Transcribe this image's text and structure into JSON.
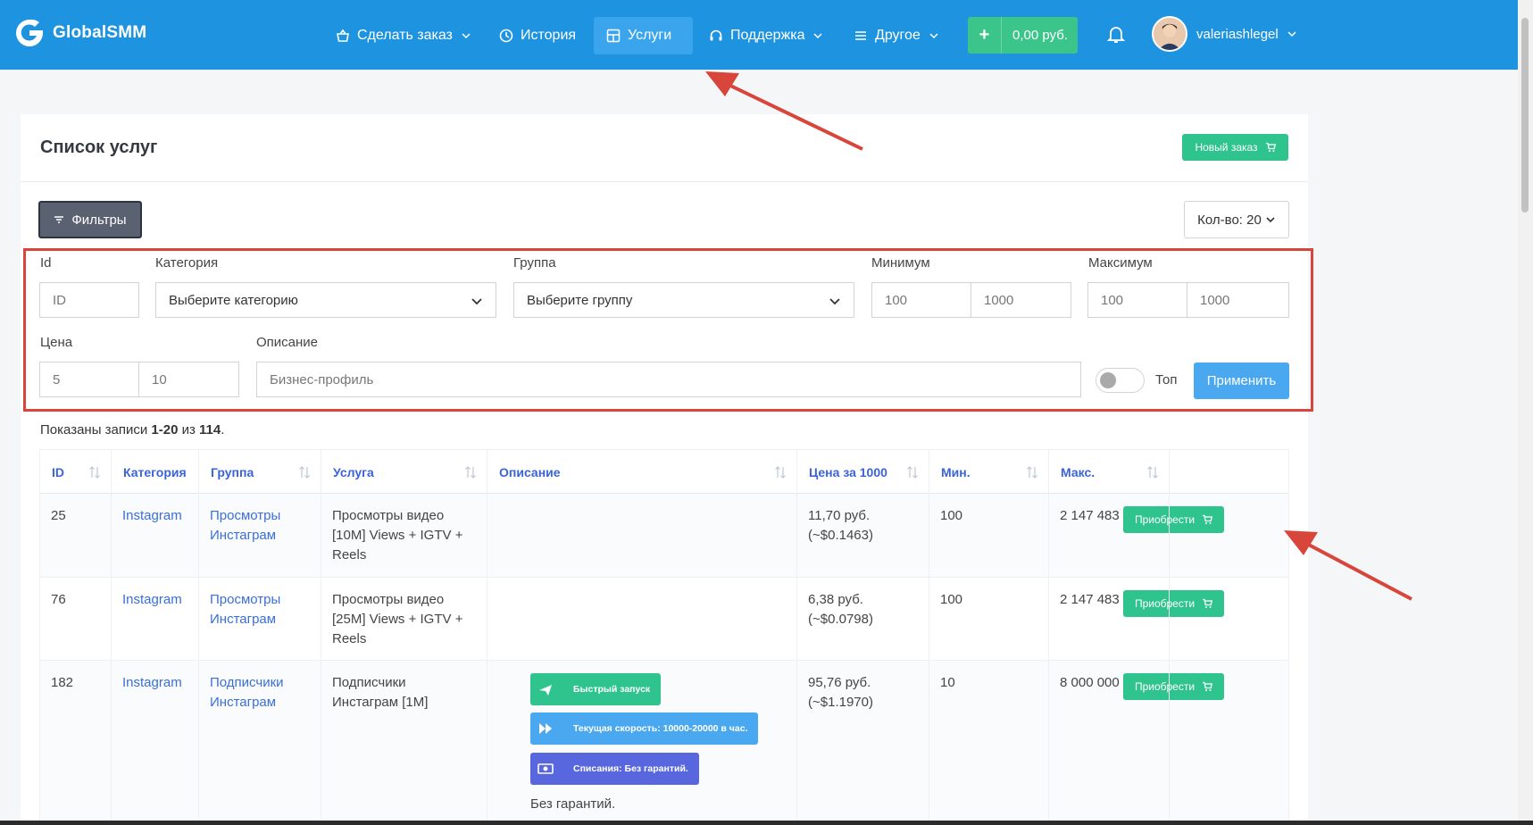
{
  "brand": {
    "name": "GlobalSMM"
  },
  "nav": {
    "order": "Сделать заказ",
    "history": "История",
    "services": "Услуги",
    "support": "Поддержка",
    "other": "Другое",
    "balance": "0,00 руб.",
    "username": "valeriashlegel"
  },
  "page": {
    "title": "Список услуг",
    "new_order": "Новый заказ",
    "filters_btn": "Фильтры",
    "qty": "Кол-во: 20"
  },
  "filters": {
    "id_label": "Id",
    "id_placeholder": "ID",
    "category_label": "Категория",
    "category_value": "Выберите категорию",
    "group_label": "Группа",
    "group_value": "Выберите группу",
    "min_label": "Минимум",
    "min_from": "100",
    "min_to": "1000",
    "max_label": "Максимум",
    "max_from": "100",
    "max_to": "1000",
    "price_label": "Цена",
    "price_from": "5",
    "price_to": "10",
    "desc_label": "Описание",
    "desc_placeholder": "Бизнес-профиль",
    "top_label": "Топ",
    "apply": "Применить"
  },
  "records": {
    "prefix": "Показаны записи ",
    "range": "1-20",
    "mid": " из ",
    "total": "114",
    "suffix": "."
  },
  "table": {
    "headers": [
      "ID",
      "Категория",
      "Группа",
      "Услуга",
      "Описание",
      "Цена за 1000",
      "Мин.",
      "Макс."
    ],
    "buy": "Приобрести",
    "rows": [
      {
        "id": "25",
        "category": "Instagram",
        "group": [
          "Просмотры",
          "Инстаграм"
        ],
        "service": [
          "Просмотры видео",
          "[10M] Views + IGTV +",
          "Reels"
        ],
        "price": [
          "11,70 руб.",
          "(~$0.1463)"
        ],
        "min": "100",
        "max": "2 147 483 647"
      },
      {
        "id": "76",
        "category": "Instagram",
        "group": [
          "Просмотры",
          "Инстаграм"
        ],
        "service": [
          "Просмотры видео",
          "[25M] Views + IGTV +",
          "Reels"
        ],
        "price": [
          "6,38 руб.",
          "(~$0.0798)"
        ],
        "min": "100",
        "max": "2 147 483 647"
      },
      {
        "id": "182",
        "category": "Instagram",
        "group": [
          "Подписчики",
          "Инстаграм"
        ],
        "service": [
          "Подписчики",
          "Инстаграм [1M]"
        ],
        "price": [
          "95,76 руб.",
          "(~$1.1970)"
        ],
        "min": "10",
        "max": "8 000 000",
        "badges": [
          "Быстрый запуск",
          "Текущая скорость: 10000-20000 в час.",
          "Списания: Без гарантий."
        ],
        "note": "Без гарантий."
      }
    ]
  },
  "colors": {
    "navbar": "#1e93e0",
    "green": "#2fc48d",
    "blue": "#4aa8f0",
    "indigo": "#5867dd",
    "annotation": "#d8453a"
  }
}
